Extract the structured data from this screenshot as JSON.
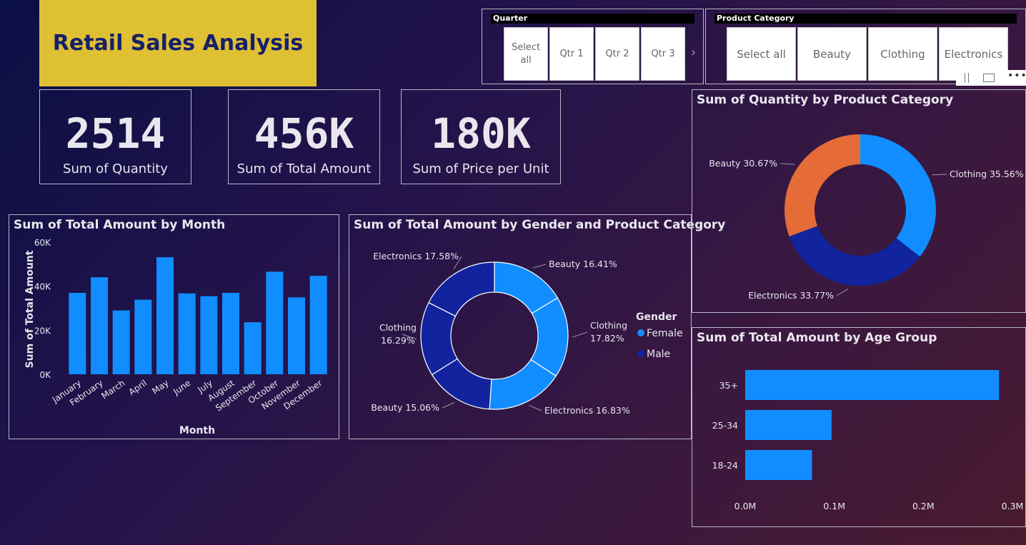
{
  "title": "Retail Sales Analysis",
  "slicers": {
    "quarter": {
      "label": "Quarter",
      "options": [
        "Select all",
        "Qtr 1",
        "Qtr 2",
        "Qtr 3"
      ]
    },
    "category": {
      "label": "Product Category",
      "options": [
        "Select all",
        "Beauty",
        "Clothing",
        "Electronics"
      ]
    }
  },
  "cards": [
    {
      "value": "2514",
      "label": "Sum of Quantity"
    },
    {
      "value": "456K",
      "label": "Sum of Total Amount"
    },
    {
      "value": "180K",
      "label": "Sum of Price per Unit"
    }
  ],
  "colors": {
    "accent": "#118dff",
    "dark": "#12239e",
    "orange": "#e66c37",
    "title_bg": "#dfc033",
    "title_text": "#16206b"
  },
  "chart_data": [
    {
      "type": "bar",
      "title": "Sum of Total Amount by Month",
      "xlabel": "Month",
      "ylabel": "Sum of Total Amount",
      "categories": [
        "January",
        "February",
        "March",
        "April",
        "May",
        "June",
        "July",
        "August",
        "September",
        "October",
        "November",
        "December"
      ],
      "values": [
        36980,
        44060,
        28990,
        33870,
        53150,
        36715,
        35465,
        36960,
        23620,
        46580,
        34920,
        44690
      ],
      "ylim": [
        0,
        60000
      ],
      "yticks": [
        "0K",
        "20K",
        "40K",
        "60K"
      ]
    },
    {
      "type": "pie",
      "title": "Sum of Total Amount by Gender and Product Category",
      "legend_title": "Gender",
      "legend": [
        "Female",
        "Male"
      ],
      "slices": [
        {
          "label": "Beauty",
          "pct": "16.41%",
          "value": 16.41,
          "gender": "Female"
        },
        {
          "label": "Clothing",
          "pct": "17.82%",
          "value": 17.82,
          "gender": "Female"
        },
        {
          "label": "Electronics",
          "pct": "16.83%",
          "value": 16.83,
          "gender": "Female"
        },
        {
          "label": "Beauty",
          "pct": "15.06%",
          "value": 15.06,
          "gender": "Male"
        },
        {
          "label": "Clothing",
          "pct": "16.29%",
          "value": 16.29,
          "gender": "Male"
        },
        {
          "label": "Electronics",
          "pct": "17.58%",
          "value": 17.58,
          "gender": "Male"
        }
      ]
    },
    {
      "type": "pie",
      "title": "Sum of Quantity by Product Category",
      "slices": [
        {
          "label": "Clothing",
          "pct": "35.56%",
          "value": 35.56
        },
        {
          "label": "Electronics",
          "pct": "33.77%",
          "value": 33.77
        },
        {
          "label": "Beauty",
          "pct": "30.67%",
          "value": 30.67
        }
      ]
    },
    {
      "type": "bar",
      "orientation": "horizontal",
      "title": "Sum of Total Amount by Age Group",
      "categories": [
        "35+",
        "25-34",
        "18-24"
      ],
      "values": [
        285000,
        97000,
        75000
      ],
      "xlim": [
        0,
        300000
      ],
      "xticks": [
        "0.0M",
        "0.1M",
        "0.2M",
        "0.3M"
      ]
    }
  ]
}
